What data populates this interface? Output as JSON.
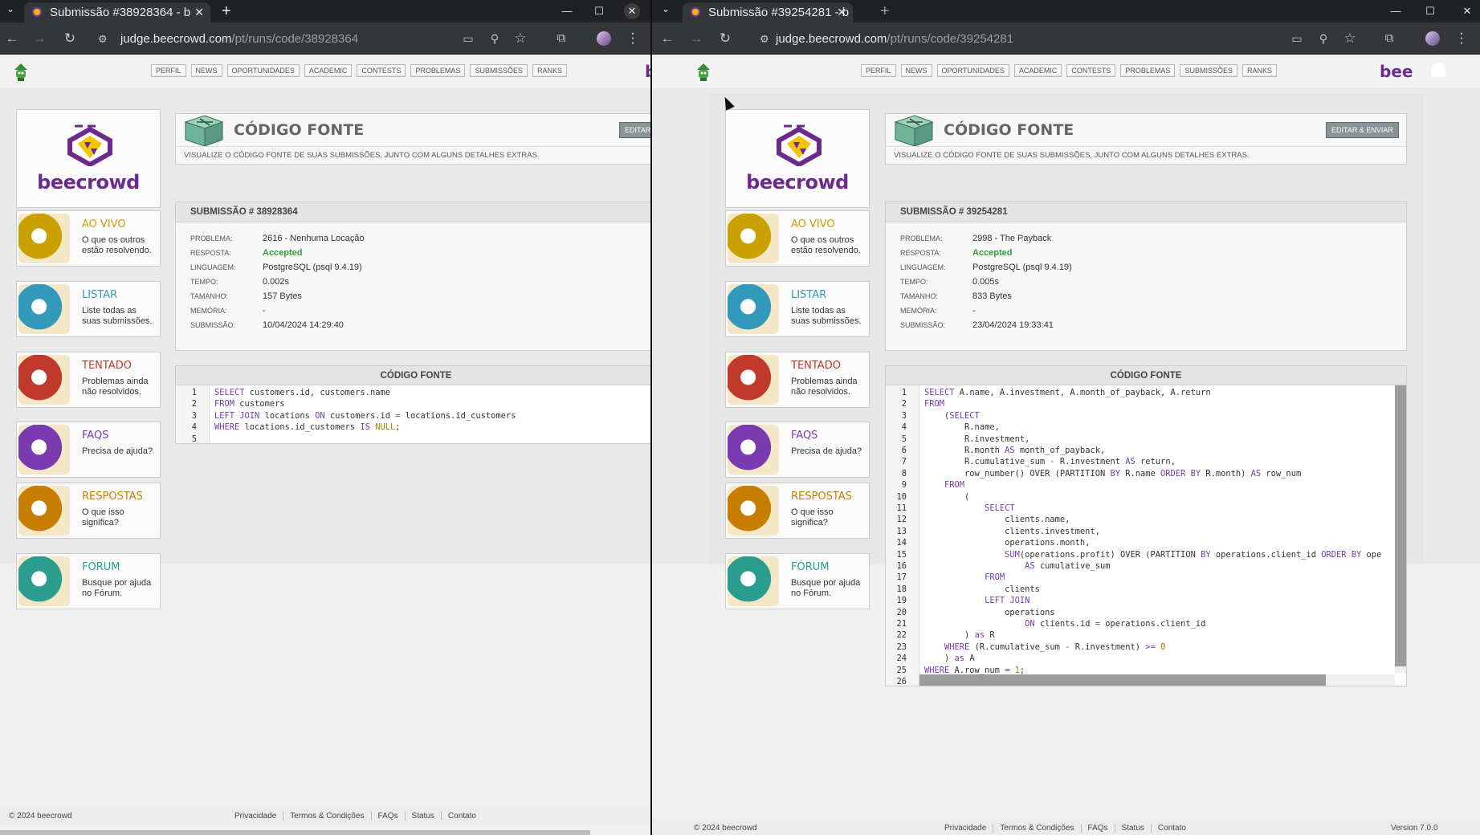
{
  "left": {
    "tab_title": "Submissão #38928364 - b",
    "url_host": "judge.beecrowd.com",
    "url_path": "/pt/runs/code/38928364",
    "edit_label": "EDITAR &",
    "submission_header": "SUBMISSÃO # 38928364",
    "problem": "2616 - Nenhuma Locação",
    "answer": "Accepted",
    "language": "PostgreSQL (psql 9.4.19)",
    "time": "0.002s",
    "size": "157 Bytes",
    "memory": "-",
    "submitted": "10/04/2024 14:29:40",
    "code": [
      [
        [
          "kw",
          "SELECT"
        ],
        [
          "t",
          " customers.id, customers.name"
        ]
      ],
      [
        [
          "kw",
          "FROM"
        ],
        [
          "t",
          " customers"
        ]
      ],
      [
        [
          "kw",
          "LEFT JOIN"
        ],
        [
          "t",
          " locations "
        ],
        [
          "kw",
          "ON"
        ],
        [
          "t",
          " customers.id "
        ],
        [
          "op",
          "="
        ],
        [
          "t",
          " locations.id_customers"
        ]
      ],
      [
        [
          "kw",
          "WHERE"
        ],
        [
          "t",
          " locations.id_customers "
        ],
        [
          "kw",
          "IS"
        ],
        [
          "t",
          " "
        ],
        [
          "nul",
          "NULL"
        ],
        [
          "t",
          ";"
        ]
      ],
      [
        [
          "t",
          ""
        ]
      ]
    ]
  },
  "right": {
    "tab_title": "Submissão #39254281 - b",
    "url_host": "judge.beecrowd.com",
    "url_path": "/pt/runs/code/39254281",
    "edit_label": "EDITAR & ENVIAR",
    "submission_header": "SUBMISSÃO # 39254281",
    "problem": "2998 - The Payback",
    "answer": "Accepted",
    "language": "PostgreSQL (psql 9.4.19)",
    "time": "0.005s",
    "size": "833 Bytes",
    "memory": "-",
    "submitted": "23/04/2024 19:33:41",
    "version": "Version 7.0.0",
    "code": [
      [
        [
          "kw",
          "SELECT"
        ],
        [
          "t",
          " A.name, A.investment, A.month_of_payback, A.return"
        ]
      ],
      [
        [
          "kw",
          "FROM"
        ]
      ],
      [
        [
          "t",
          "    ("
        ],
        [
          "kw",
          "SELECT"
        ]
      ],
      [
        [
          "t",
          "        R.name,"
        ]
      ],
      [
        [
          "t",
          "        R.investment,"
        ]
      ],
      [
        [
          "t",
          "        R.month "
        ],
        [
          "kw",
          "AS"
        ],
        [
          "t",
          " month_of_payback,"
        ]
      ],
      [
        [
          "t",
          "        R.cumulative_sum "
        ],
        [
          "op",
          "-"
        ],
        [
          "t",
          " R.investment "
        ],
        [
          "kw",
          "AS"
        ],
        [
          "t",
          " return,"
        ]
      ],
      [
        [
          "t",
          "        row_number() OVER (PARTITION "
        ],
        [
          "kw",
          "BY"
        ],
        [
          "t",
          " R.name "
        ],
        [
          "kw",
          "ORDER BY"
        ],
        [
          "t",
          " R.month) "
        ],
        [
          "kw",
          "AS"
        ],
        [
          "t",
          " row_num"
        ]
      ],
      [
        [
          "t",
          "    "
        ],
        [
          "kw",
          "FROM"
        ]
      ],
      [
        [
          "t",
          "        ("
        ]
      ],
      [
        [
          "t",
          "            "
        ],
        [
          "kw",
          "SELECT"
        ]
      ],
      [
        [
          "t",
          "                clients.name,"
        ]
      ],
      [
        [
          "t",
          "                clients.investment,"
        ]
      ],
      [
        [
          "t",
          "                operations.month,"
        ]
      ],
      [
        [
          "t",
          "                "
        ],
        [
          "kw",
          "SUM"
        ],
        [
          "t",
          "(operations.profit) OVER (PARTITION "
        ],
        [
          "kw",
          "BY"
        ],
        [
          "t",
          " operations.client_id "
        ],
        [
          "kw",
          "ORDER BY"
        ],
        [
          "t",
          " ope"
        ]
      ],
      [
        [
          "t",
          "                    "
        ],
        [
          "kw",
          "AS"
        ],
        [
          "t",
          " cumulative_sum"
        ]
      ],
      [
        [
          "t",
          "            "
        ],
        [
          "kw",
          "FROM"
        ]
      ],
      [
        [
          "t",
          "                clients"
        ]
      ],
      [
        [
          "t",
          "            "
        ],
        [
          "kw",
          "LEFT JOIN"
        ]
      ],
      [
        [
          "t",
          "                operations"
        ]
      ],
      [
        [
          "t",
          "                    "
        ],
        [
          "kw",
          "ON"
        ],
        [
          "t",
          " clients.id "
        ],
        [
          "op",
          "="
        ],
        [
          "t",
          " operations.client_id"
        ]
      ],
      [
        [
          "t",
          "        ) "
        ],
        [
          "kw",
          "as"
        ],
        [
          "t",
          " R"
        ]
      ],
      [
        [
          "t",
          "    "
        ],
        [
          "kw",
          "WHERE"
        ],
        [
          "t",
          " (R.cumulative_sum "
        ],
        [
          "op",
          "-"
        ],
        [
          "t",
          " R.investment) "
        ],
        [
          "op",
          ">="
        ],
        [
          "t",
          " "
        ],
        [
          "num",
          "0"
        ]
      ],
      [
        [
          "t",
          "    ) "
        ],
        [
          "kw",
          "as"
        ],
        [
          "t",
          " A"
        ]
      ],
      [
        [
          "kw",
          "WHERE"
        ],
        [
          "t",
          " A.row_num "
        ],
        [
          "op",
          "="
        ],
        [
          "t",
          " "
        ],
        [
          "num",
          "1"
        ],
        [
          "t",
          ";"
        ]
      ],
      [
        [
          "t",
          ""
        ]
      ]
    ]
  },
  "labels": {
    "problem": "PROBLEMA:",
    "answer": "RESPOSTA:",
    "language": "LINGUAGEM:",
    "time": "TEMPO:",
    "size": "TAMANHO:",
    "memory": "MEMÓRIA:",
    "submitted": "SUBMISSÃO:",
    "header_title": "CÓDIGO FONTE",
    "header_sub": "VISUALIZE O CÓDIGO FONTE DE SUAS SUBMISSÕES, JUNTO COM ALGUNS DETALHES EXTRAS.",
    "code_title": "CÓDIGO FONTE"
  },
  "nav": [
    "PERFIL",
    "NEWS",
    "OPORTUNIDADES",
    "ACADEMIC",
    "CONTESTS",
    "PROBLEMAS",
    "SUBMISSÕES",
    "RANKS"
  ],
  "brand": {
    "logo_word": "beecrowd",
    "short": "bee",
    "short_left": "b"
  },
  "sidebar": [
    {
      "title": "AO VIVO",
      "desc": "O que os outros estão resolvendo.",
      "color": "#c9a100",
      "icon": "globe-clock-icon"
    },
    {
      "title": "LISTAR",
      "desc": "Liste todas as suas submissões.",
      "color": "#3399bb",
      "icon": "list-sheet-icon"
    },
    {
      "title": "TENTADO",
      "desc": "Problemas ainda não resolvidos.",
      "color": "#c0392b",
      "icon": "burning-box-icon"
    },
    {
      "title": "FAQS",
      "desc": "Precisa de ajuda?",
      "color": "#7a3ab0",
      "icon": "question-bubble-icon"
    },
    {
      "title": "RESPOSTAS",
      "desc": "O que isso significa?",
      "color": "#c77d00",
      "icon": "lightbulb-icon"
    },
    {
      "title": "FÓRUM",
      "desc": "Busque por ajuda no Fórum.",
      "color": "#2a9d8f",
      "icon": "forum-chat-icon"
    }
  ],
  "footer": {
    "copy": "© 2024 beecrowd",
    "links": [
      "Privacidade",
      "Termos & Condições",
      "FAQs",
      "Status",
      "Contato"
    ]
  },
  "colors": {
    "brand": "#6b2b8c",
    "accepted": "#3a9a3a",
    "keyword": "#7a3ab0"
  }
}
